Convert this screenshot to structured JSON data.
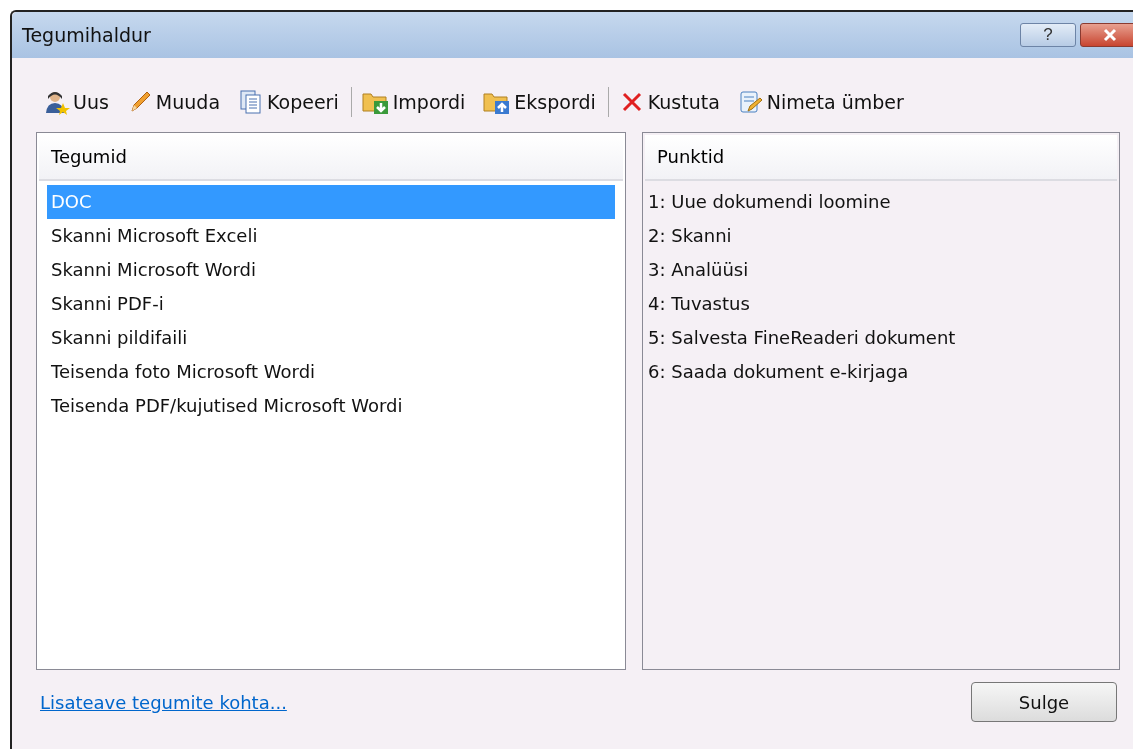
{
  "window": {
    "title": "Tegumihaldur",
    "help_button": "?"
  },
  "toolbar": [
    {
      "buttons": [
        {
          "kind": "new",
          "label": "Uus"
        },
        {
          "kind": "edit",
          "label": "Muuda"
        },
        {
          "kind": "copy",
          "label": "Kopeeri"
        }
      ]
    },
    {
      "buttons": [
        {
          "kind": "import",
          "label": "Impordi"
        },
        {
          "kind": "export",
          "label": "Ekspordi"
        }
      ]
    },
    {
      "buttons": [
        {
          "kind": "delete",
          "label": "Kustuta"
        },
        {
          "kind": "rename",
          "label": "Nimeta ümber"
        }
      ]
    }
  ],
  "tasks": {
    "header": "Tegumid",
    "items": [
      {
        "label": "DOC",
        "selected": true
      },
      {
        "label": "Skanni Microsoft Exceli",
        "selected": false
      },
      {
        "label": "Skanni Microsoft Wordi",
        "selected": false
      },
      {
        "label": "Skanni PDF-i",
        "selected": false
      },
      {
        "label": "Skanni pildifaili",
        "selected": false
      },
      {
        "label": "Teisenda foto Microsoft Wordi",
        "selected": false
      },
      {
        "label": "Teisenda PDF/kujutised Microsoft Wordi",
        "selected": false
      }
    ]
  },
  "steps": {
    "header": "Punktid",
    "items": [
      "1: Uue dokumendi loomine",
      "2: Skanni",
      "3: Analüüsi",
      "4: Tuvastus",
      "5: Salvesta FineReaderi dokument",
      "6: Saada dokument e-kirjaga"
    ]
  },
  "footer": {
    "link": "Lisateave tegumite kohta...",
    "close_button": "Sulge"
  }
}
